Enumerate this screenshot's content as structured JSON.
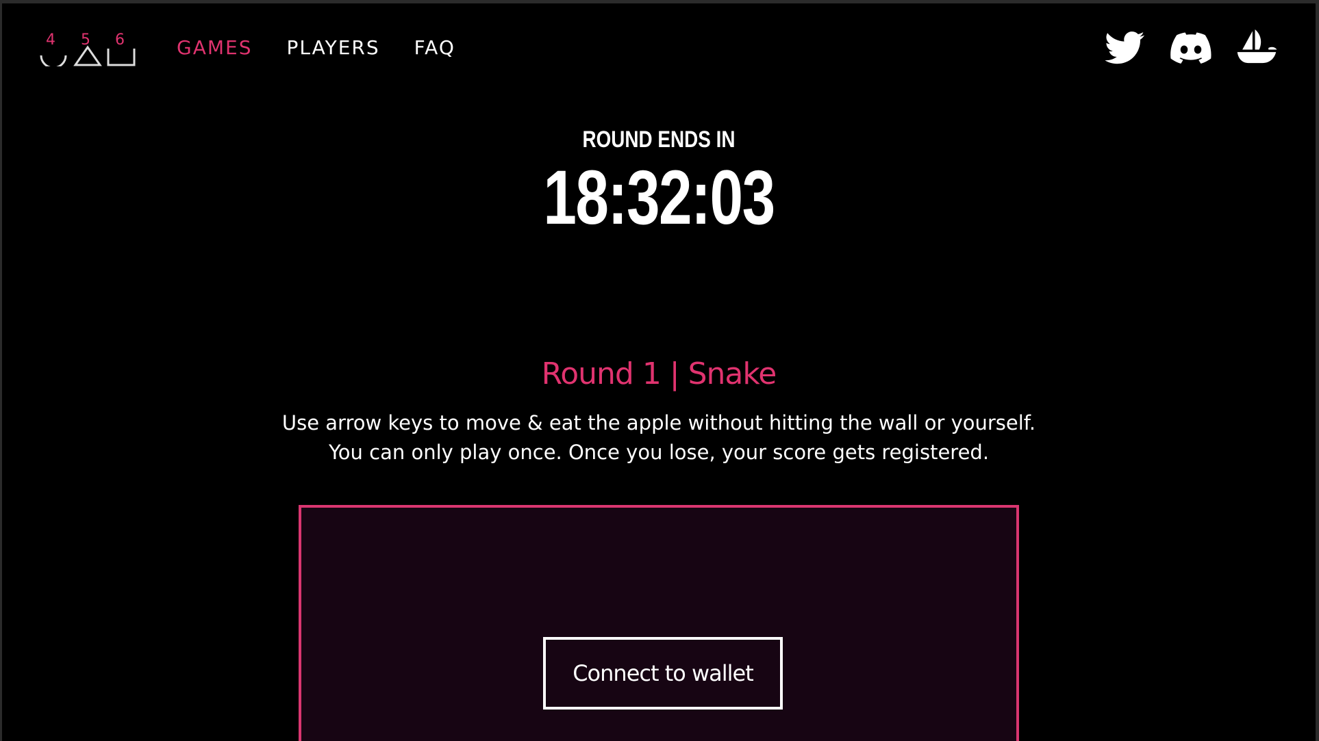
{
  "logo": {
    "digits": [
      "4",
      "5",
      "6"
    ],
    "icon": "456-logo"
  },
  "nav": {
    "items": [
      {
        "label": "GAMES",
        "active": true
      },
      {
        "label": "PLAYERS",
        "active": false
      },
      {
        "label": "FAQ",
        "active": false
      }
    ]
  },
  "social": {
    "items": [
      {
        "icon": "twitter-icon"
      },
      {
        "icon": "discord-icon"
      },
      {
        "icon": "opensea-icon"
      }
    ]
  },
  "timer": {
    "label": "ROUND ENDS IN",
    "value": "18:32:03"
  },
  "round": {
    "title": "Round 1 | Snake",
    "description_line1": "Use arrow keys to move & eat the apple without hitting the wall or yourself.",
    "description_line2": "You can only play once. Once you lose, your score gets registered."
  },
  "game": {
    "connect_label": "Connect to wallet"
  },
  "colors": {
    "accent": "#e0336f",
    "background": "#000000",
    "game_bg": "#170513",
    "border": "#d93670"
  }
}
